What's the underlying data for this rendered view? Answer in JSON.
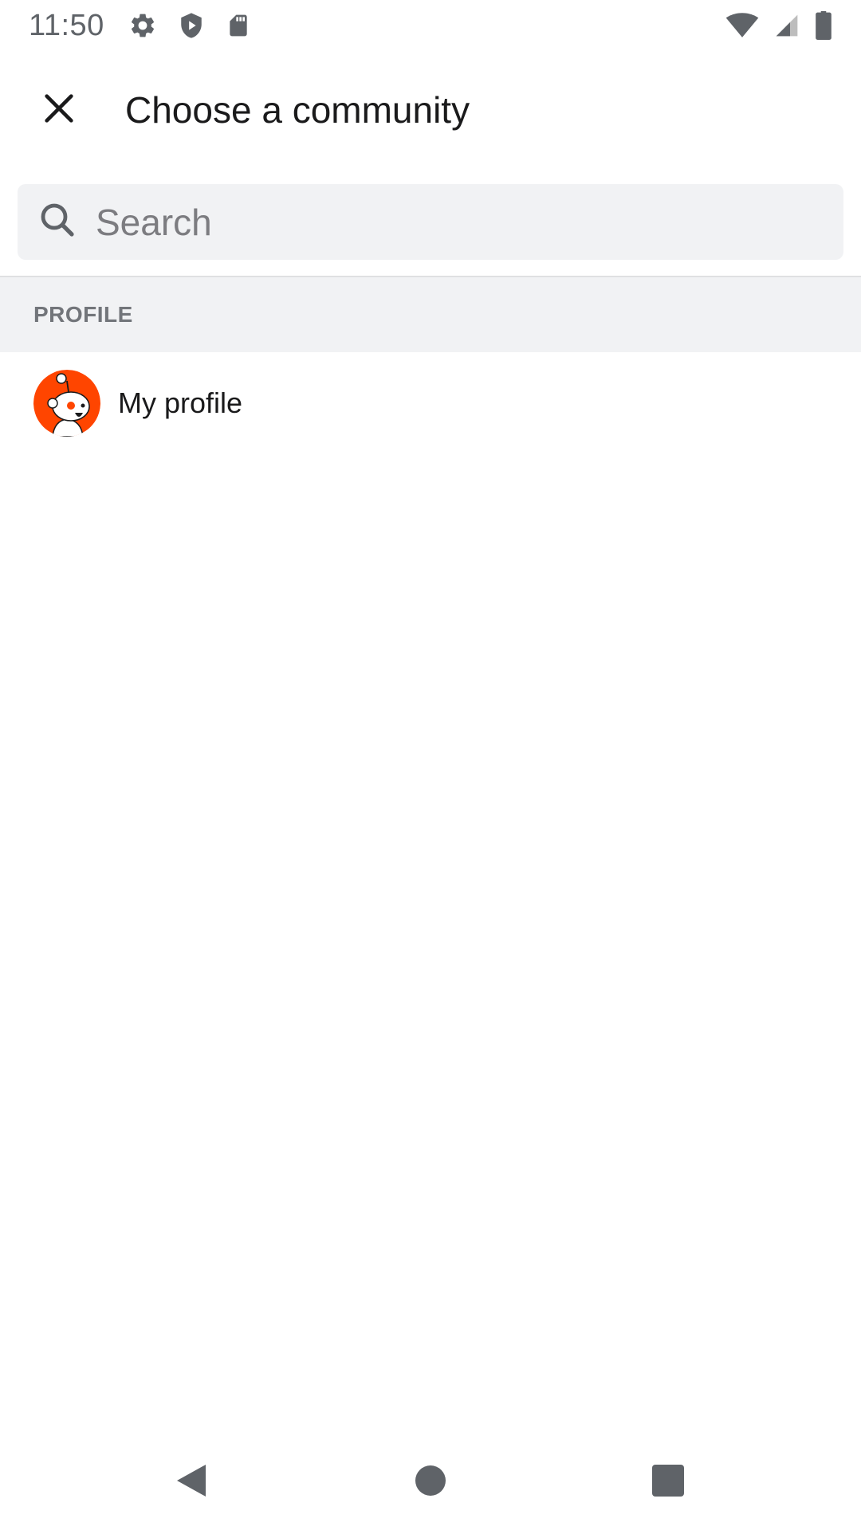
{
  "status_bar": {
    "time": "11:50",
    "left_icons": [
      "settings-icon",
      "shield-play-icon",
      "sd-card-icon"
    ],
    "right_icons": [
      "wifi-icon",
      "signal-icon",
      "battery-icon"
    ],
    "icon_color": "#5f6368"
  },
  "app_bar": {
    "title": "Choose a community",
    "close_icon": "close-icon"
  },
  "search": {
    "placeholder": "Search",
    "value": "",
    "icon": "search-icon"
  },
  "sections": [
    {
      "label": "PROFILE",
      "items": [
        {
          "label": "My profile",
          "avatar": "reddit-snoo-avatar",
          "avatar_color": "#ff4500"
        }
      ]
    }
  ],
  "nav_bar": {
    "buttons": [
      "back-icon",
      "home-icon",
      "recents-icon"
    ]
  }
}
